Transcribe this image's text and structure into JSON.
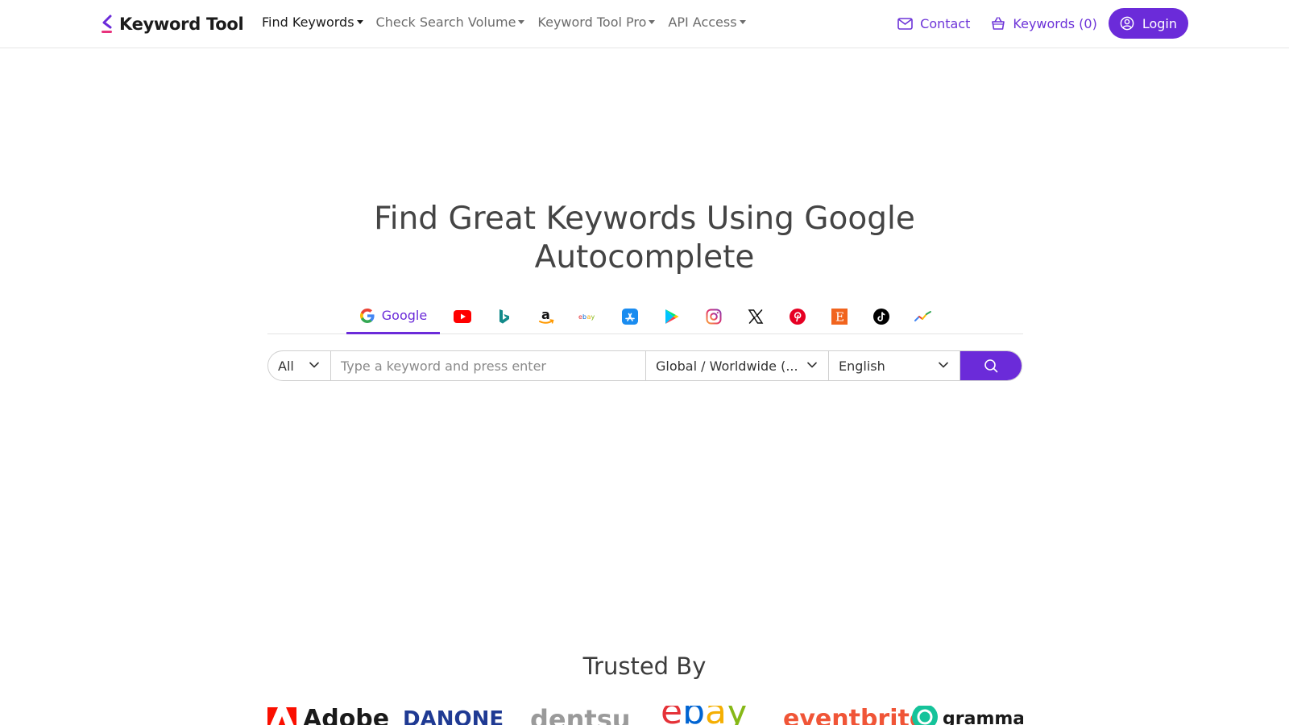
{
  "header": {
    "logo_text": "Keyword Tool",
    "nav": [
      {
        "label": "Find Keywords",
        "active": true
      },
      {
        "label": "Check Search Volume",
        "active": false
      },
      {
        "label": "Keyword Tool Pro",
        "active": false
      },
      {
        "label": "API Access",
        "active": false
      }
    ],
    "contact_label": "Contact",
    "keywords_label": "Keywords (0)",
    "login_label": "Login"
  },
  "hero": {
    "title": "Find Great Keywords Using Google Autocomplete"
  },
  "tabs": {
    "active_label": "Google",
    "items": [
      "google-icon",
      "youtube-icon",
      "bing-icon",
      "amazon-icon",
      "ebay-icon",
      "app-store-icon",
      "play-store-icon",
      "instagram-icon",
      "x-icon",
      "pinterest-icon",
      "etsy-icon",
      "tiktok-icon",
      "trends-icon"
    ]
  },
  "search": {
    "type_value": "All",
    "keyword_placeholder": "Type a keyword and press enter",
    "location_value": "Global / Worldwide (...",
    "language_value": "English"
  },
  "trusted": {
    "title": "Trusted By",
    "brands": [
      "Adobe",
      "DANONE",
      "dentsu",
      "ebay",
      "eventbrite",
      "grammarly"
    ]
  },
  "colors": {
    "accent": "#6b2bd9"
  }
}
